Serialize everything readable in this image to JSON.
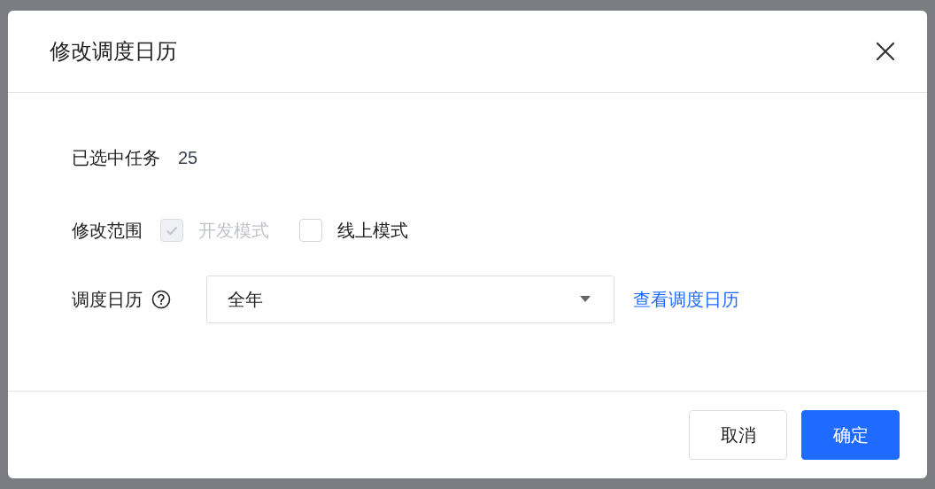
{
  "dialog": {
    "title": "修改调度日历",
    "selected_tasks": {
      "label": "已选中任务",
      "value": "25"
    },
    "scope": {
      "label": "修改范围",
      "options": [
        {
          "label": "开发模式",
          "checked": true,
          "disabled": true
        },
        {
          "label": "线上模式",
          "checked": false,
          "disabled": false
        }
      ]
    },
    "calendar": {
      "label": "调度日历",
      "value": "全年",
      "link": "查看调度日历"
    },
    "buttons": [
      {
        "label": "取消",
        "kind": "secondary"
      },
      {
        "label": "确定",
        "kind": "primary"
      }
    ]
  }
}
